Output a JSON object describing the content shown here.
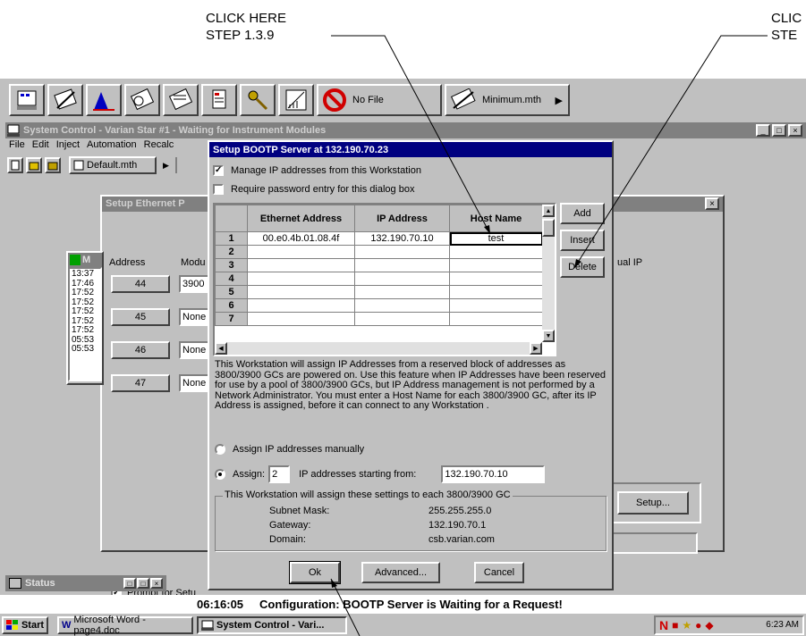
{
  "annotations": {
    "left_line1": "CLICK HERE",
    "left_line2": "STEP 1.3.9",
    "right_line1": "CLIC",
    "right_line2": "STE"
  },
  "toolbar": {
    "nofile_label": "No File",
    "method_label": "Minimum.mth"
  },
  "main_window": {
    "title": "System Control - Varian Star #1 - Waiting for Instrument Modules",
    "menu": [
      "File",
      "Edit",
      "Inject",
      "Automation",
      "Recalc"
    ],
    "method_label": "Default.mth",
    "status_time": "06:16:05",
    "status_message": "Configuration: BOOTP Server is Waiting for a Request!"
  },
  "ethernet_panel": {
    "title": "Setup Ethernet P",
    "address_header": "Address",
    "module_header": "Modu",
    "rows": [
      {
        "address": "44",
        "module": "3900"
      },
      {
        "address": "45",
        "module": "None"
      },
      {
        "address": "46",
        "module": "None"
      },
      {
        "address": "47",
        "module": "None"
      }
    ],
    "right_text": "ual IP",
    "setup_label": "Setup...",
    "prompt_label": "Prompt for Setu"
  },
  "log_window": {
    "title": "M",
    "times": [
      "13:37",
      "17:46",
      "17:52",
      "17:52",
      "17:52",
      "17:52",
      "17:52",
      "05:53",
      "05:53"
    ]
  },
  "status_window": {
    "title": "Status"
  },
  "dialog": {
    "title": "Setup BOOTP Server at 132.190.70.23",
    "manage_label": "Manage IP addresses from this Workstation",
    "password_label": "Require password entry for this dialog box",
    "table": {
      "columns": [
        "Ethernet Address",
        "IP Address",
        "Host Name"
      ],
      "row_numbers": [
        "1",
        "2",
        "3",
        "4",
        "5",
        "6",
        "7"
      ],
      "row1": {
        "ethernet": "00.e0.4b.01.08.4f",
        "ip": "132.190.70.10",
        "host": "test"
      }
    },
    "add_label": "Add",
    "insert_label": "Insert",
    "delete_label": "Delete",
    "description": "This Workstation will assign IP Addresses from a reserved block of addresses as 3800/3900 GCs are powered on.  Use this feature when IP Addresses have been reserved for use by a pool of 3800/3900 GCs, but IP Address management is not performed by a Network Administrator.  You must enter a Host Name for each 3800/3900 GC, after its IP Address is assigned, before it can connect to any Workstation .",
    "manual_label": "Assign IP addresses manually",
    "assign_label": "Assign:",
    "assign_count": "2",
    "starting_label": "IP addresses starting from:",
    "starting_ip": "132.190.70.10",
    "group_label": "This Workstation will assign these settings to each 3800/3900 GC",
    "subnet_label": "Subnet Mask:",
    "subnet_value": "255.255.255.0",
    "gateway_label": "Gateway:",
    "gateway_value": "132.190.70.1",
    "domain_label": "Domain:",
    "domain_value": "csb.varian.com",
    "ok_label": "Ok",
    "advanced_label": "Advanced...",
    "cancel_label": "Cancel"
  },
  "taskbar": {
    "start_label": "Start",
    "word_label": "Microsoft Word - page4.doc",
    "sysctl_label": "System Control - Vari...",
    "clock": "6:23 AM"
  }
}
